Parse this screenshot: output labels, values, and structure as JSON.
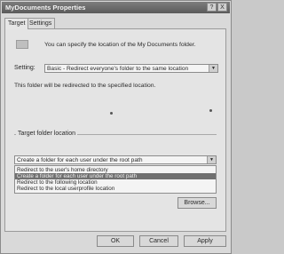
{
  "window": {
    "title": "MyDocuments Properties",
    "help_glyph": "?",
    "close_glyph": "X"
  },
  "tabs": [
    {
      "label": "Target",
      "active": true
    },
    {
      "label": "Settings",
      "active": false
    }
  ],
  "intro_text": "You can specify the location of the My Documents folder.",
  "setting": {
    "label": "Setting:",
    "value": "Basic - Redirect everyone's folder to the same location"
  },
  "redirect_note": "This folder will be redirected to the specified location.",
  "target_group": {
    "label": "Target folder location",
    "combo_value": "Create a folder for each user under the root path",
    "options": [
      {
        "label": "Redirect to the user's home directory",
        "selected": false
      },
      {
        "label": "Create a folder for each user under the root path",
        "selected": true
      },
      {
        "label": "Redirect to the following location",
        "selected": false
      },
      {
        "label": "Redirect to the local userprofile location",
        "selected": false
      }
    ],
    "browse_label": "Browse..."
  },
  "footer": {
    "ok_label": "OK",
    "cancel_label": "Cancel",
    "apply_label": "Apply"
  }
}
